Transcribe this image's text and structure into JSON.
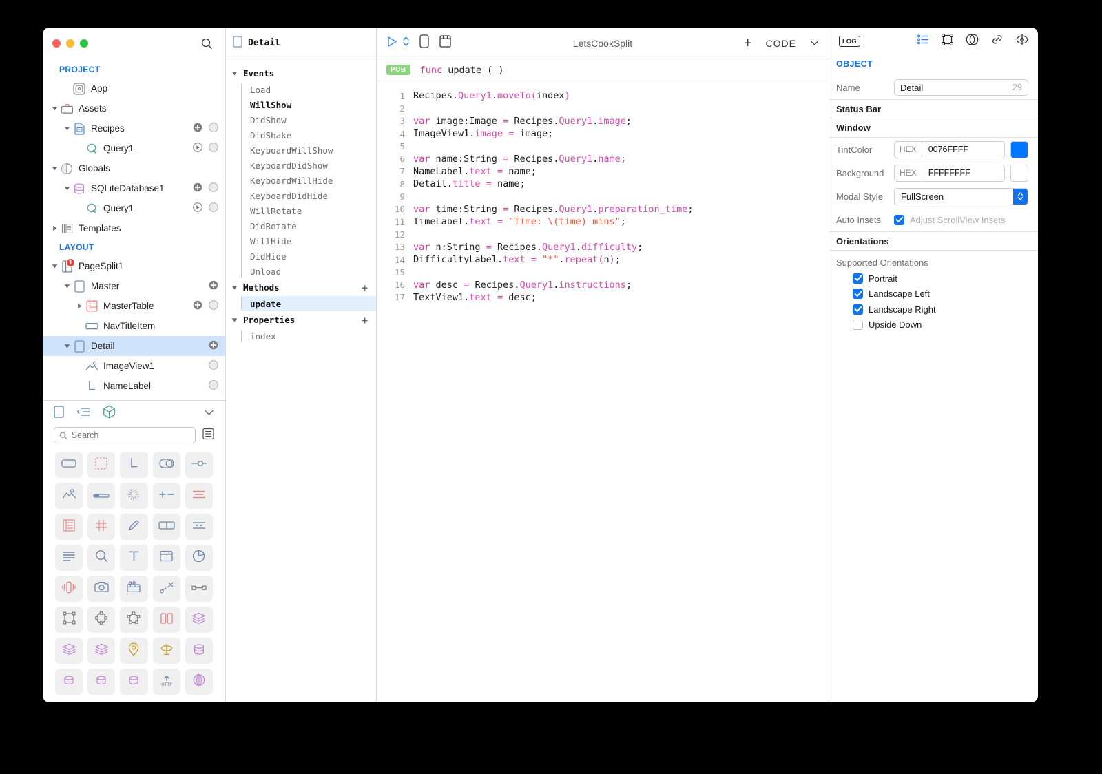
{
  "window": {
    "title": "LetsCookSplit"
  },
  "sidebar": {
    "search_icon": "search-icon",
    "groups": [
      {
        "title": "PROJECT"
      },
      {
        "title": "LAYOUT"
      }
    ],
    "project_items": [
      {
        "label": "App",
        "icon": "app-icon",
        "depth": 1,
        "twisty": "none",
        "actions": []
      },
      {
        "label": "Assets",
        "icon": "briefcase-icon",
        "depth": 0,
        "twisty": "open",
        "actions": []
      },
      {
        "label": "Recipes",
        "icon": "document-icon",
        "depth": 1,
        "twisty": "open",
        "actions": [
          "plus",
          "circle"
        ]
      },
      {
        "label": "Query1",
        "icon": "query-icon",
        "depth": 2,
        "twisty": "none",
        "actions": [
          "play",
          "circle"
        ]
      },
      {
        "label": "Globals",
        "icon": "globals-icon",
        "depth": 0,
        "twisty": "open",
        "actions": []
      },
      {
        "label": "SQLiteDatabase1",
        "icon": "database-icon",
        "depth": 1,
        "twisty": "open",
        "actions": [
          "plus",
          "circle"
        ]
      },
      {
        "label": "Query1",
        "icon": "query-icon",
        "depth": 2,
        "twisty": "none",
        "actions": [
          "play",
          "circle"
        ]
      },
      {
        "label": "Templates",
        "icon": "templates-icon",
        "depth": 0,
        "twisty": "closed",
        "actions": []
      }
    ],
    "layout_items": [
      {
        "label": "PageSplit1",
        "icon": "pagesplit-icon",
        "depth": 0,
        "twisty": "open",
        "actions": [],
        "badge": "1",
        "selected": false
      },
      {
        "label": "Master",
        "icon": "page-icon",
        "depth": 1,
        "twisty": "open",
        "actions": [
          "plus"
        ],
        "selected": false
      },
      {
        "label": "MasterTable",
        "icon": "table-icon",
        "depth": 2,
        "twisty": "closed",
        "actions": [
          "plus",
          "circle"
        ],
        "selected": false
      },
      {
        "label": "NavTitleItem",
        "icon": "navitem-icon",
        "depth": 2,
        "twisty": "none",
        "actions": [],
        "selected": false
      },
      {
        "label": "Detail",
        "icon": "page-icon",
        "depth": 1,
        "twisty": "open",
        "actions": [
          "plus"
        ],
        "selected": true
      },
      {
        "label": "ImageView1",
        "icon": "imageview-icon",
        "depth": 2,
        "twisty": "none",
        "actions": [
          "circle"
        ],
        "selected": false
      },
      {
        "label": "NameLabel",
        "icon": "label-icon",
        "depth": 2,
        "twisty": "none",
        "actions": [
          "circle"
        ],
        "selected": false
      }
    ],
    "palette": {
      "tabs": [
        "page-tab-icon",
        "list-tab-icon",
        "object-tab-icon"
      ],
      "collapse_icon": "chevron-down-icon",
      "search_placeholder": "Search",
      "search_value": "",
      "list_toggle_icon": "list-view-icon",
      "items": [
        "button-icon",
        "placeholder-icon",
        "label-icon",
        "switch-icon",
        "slider-icon",
        "imageview-icon",
        "progressbar-icon",
        "activity-indicator-icon",
        "stepper-icon",
        "segmented-icon",
        "table-icon",
        "collection-icon",
        "pen-icon",
        "splitview-icon",
        "picker-icon",
        "textview-icon",
        "searchbar-icon",
        "text-icon",
        "webview-icon",
        "chart-icon",
        "vibration-icon",
        "camera-icon",
        "video-icon",
        "path-icon",
        "connector-icon",
        "frame-icon",
        "circle-shape-icon",
        "polygon-icon",
        "columns-icon",
        "stack-db-icon",
        "stack-db-icon",
        "stack-db-icon",
        "map-pin-icon",
        "gyro-icon",
        "database-icon",
        "db-row-icon",
        "db-row-icon",
        "db-row-icon",
        "http-icon",
        "network-icon"
      ]
    }
  },
  "events_panel": {
    "header": {
      "icon": "page-icon",
      "title": "Detail"
    },
    "sections": [
      {
        "name": "Events",
        "twisty": "open",
        "add": false,
        "items": [
          {
            "label": "Load",
            "state": "normal"
          },
          {
            "label": "WillShow",
            "state": "bold"
          },
          {
            "label": "DidShow",
            "state": "normal"
          },
          {
            "label": "DidShake",
            "state": "normal"
          },
          {
            "label": "KeyboardWillShow",
            "state": "normal"
          },
          {
            "label": "KeyboardDidShow",
            "state": "normal"
          },
          {
            "label": "KeyboardWillHide",
            "state": "normal"
          },
          {
            "label": "KeyboardDidHide",
            "state": "normal"
          },
          {
            "label": "WillRotate",
            "state": "normal"
          },
          {
            "label": "DidRotate",
            "state": "normal"
          },
          {
            "label": "WillHide",
            "state": "normal"
          },
          {
            "label": "DidHide",
            "state": "normal"
          },
          {
            "label": "Unload",
            "state": "normal"
          }
        ]
      },
      {
        "name": "Methods",
        "twisty": "open",
        "add": true,
        "items": [
          {
            "label": "update",
            "state": "selected"
          }
        ]
      },
      {
        "name": "Properties",
        "twisty": "open",
        "add": true,
        "items": [
          {
            "label": "index",
            "state": "normal"
          }
        ]
      }
    ],
    "add_label": "+"
  },
  "toolbar": {
    "run_icon": "run-icon",
    "updown_icon": "updown-icon",
    "device_icon": "device-icon",
    "module_icon": "module-icon",
    "title": "LetsCookSplit",
    "plus_label": "+",
    "mode_label": "CODE",
    "mode_chevron": "chevron-down-icon"
  },
  "editor": {
    "visibility_badge": "PUB",
    "signature_keyword": "func",
    "signature_rest": "update ( )",
    "lines": [
      {
        "n": "1",
        "text": "Recipes.Query1.moveTo(index)"
      },
      {
        "n": "2",
        "text": ""
      },
      {
        "n": "3",
        "text": "var image:Image = Recipes.Query1.image;"
      },
      {
        "n": "4",
        "text": "ImageView1.image = image;"
      },
      {
        "n": "5",
        "text": ""
      },
      {
        "n": "6",
        "text": "var name:String = Recipes.Query1.name;"
      },
      {
        "n": "7",
        "text": "NameLabel.text = name;"
      },
      {
        "n": "8",
        "text": "Detail.title = name;"
      },
      {
        "n": "9",
        "text": ""
      },
      {
        "n": "10",
        "text": "var time:String = Recipes.Query1.preparation_time;"
      },
      {
        "n": "11",
        "text": "TimeLabel.text = \"Time: \\(time) mins\";"
      },
      {
        "n": "12",
        "text": ""
      },
      {
        "n": "13",
        "text": "var n:String = Recipes.Query1.difficulty;"
      },
      {
        "n": "14",
        "text": "DifficultyLabel.text = \"*\".repeat(n);"
      },
      {
        "n": "15",
        "text": ""
      },
      {
        "n": "16",
        "text": "var desc = Recipes.Query1.instructions;"
      },
      {
        "n": "17",
        "text": "TextView1.text = desc;"
      }
    ]
  },
  "inspector": {
    "log_label": "LOG",
    "icons": [
      "attributes-icon",
      "size-icon",
      "appearance-icon",
      "bindings-icon",
      "preview-icon"
    ],
    "object_header": "OBJECT",
    "name_label": "Name",
    "name_value": "Detail",
    "name_suffix": "29",
    "status_bar_section": "Status Bar",
    "window_section": "Window",
    "tint_label": "TintColor",
    "tint_tag": "HEX",
    "tint_value": "0076FFFF",
    "tint_color": "#0076FF",
    "background_label": "Background",
    "background_tag": "HEX",
    "background_value": "FFFFFFFF",
    "background_color": "#FFFFFF",
    "modal_label": "Modal Style",
    "modal_value": "FullScreen",
    "auto_insets_label": "Auto Insets",
    "auto_insets_checked": true,
    "auto_insets_text": "Adjust ScrollView Insets",
    "orientations_section": "Orientations",
    "supported_label": "Supported Orientations",
    "orientations": [
      {
        "label": "Portrait",
        "checked": true
      },
      {
        "label": "Landscape Left",
        "checked": true
      },
      {
        "label": "Landscape Right",
        "checked": true
      },
      {
        "label": "Upside Down",
        "checked": false
      }
    ]
  },
  "colors": {
    "accent": "#1272ec",
    "selection": "#cfe3fb",
    "pub_green": "#8cd47e",
    "badge_red": "#e8453c"
  }
}
